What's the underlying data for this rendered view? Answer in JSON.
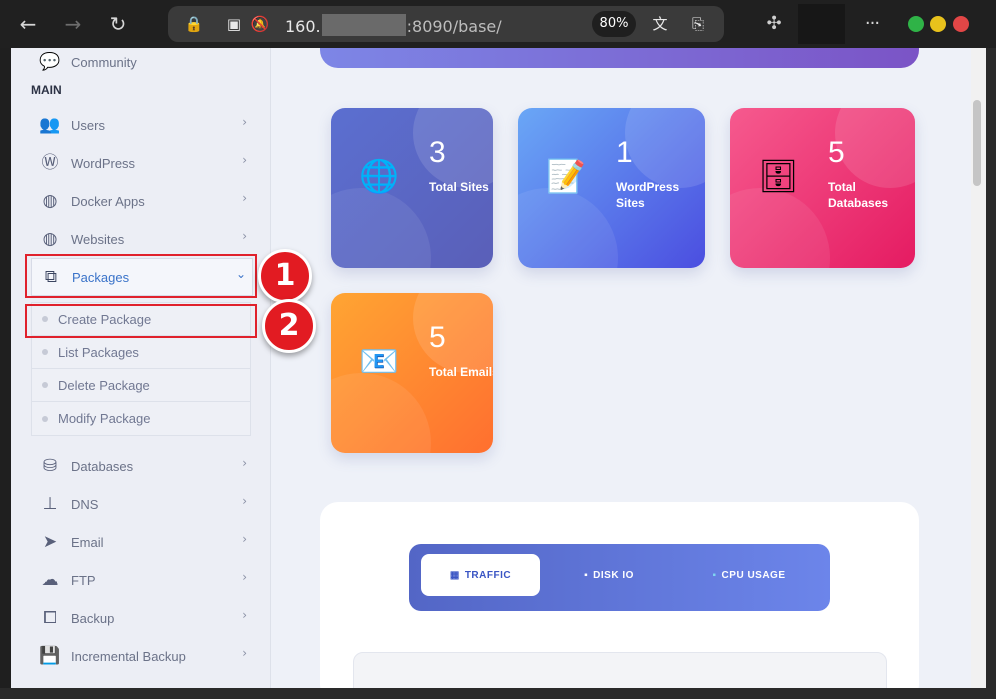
{
  "browser": {
    "back_icon": "arrow-left-icon",
    "forward_icon": "arrow-right-icon",
    "reload_icon": "reload-icon",
    "url_host": "160.",
    "url_rest": ":8090/base/",
    "zoom": "80%",
    "menu_glyph": "···"
  },
  "sidebar": {
    "community": "Community",
    "main_label": "MAIN",
    "items": [
      {
        "label": "Users",
        "icon": "users-icon"
      },
      {
        "label": "WordPress",
        "icon": "wordpress-icon"
      },
      {
        "label": "Docker Apps",
        "icon": "globe-icon"
      },
      {
        "label": "Websites",
        "icon": "globe-icon"
      },
      {
        "label": "Packages",
        "icon": "cubes-icon"
      },
      {
        "label": "Databases",
        "icon": "database-icon"
      },
      {
        "label": "DNS",
        "icon": "sitemap-icon"
      },
      {
        "label": "Email",
        "icon": "paper-plane-icon"
      },
      {
        "label": "FTP",
        "icon": "cloud-upload-icon"
      },
      {
        "label": "Backup",
        "icon": "copy-icon"
      },
      {
        "label": "Incremental Backup",
        "icon": "save-icon"
      }
    ],
    "packages_submenu": [
      "Create Package",
      "List Packages",
      "Delete Package",
      "Modify Package"
    ]
  },
  "annotations": {
    "badge_1": "1",
    "badge_2": "2",
    "color": "#e21b22"
  },
  "stats": [
    {
      "value": "3",
      "label": "Total Sites",
      "icon": "globe-icon"
    },
    {
      "value": "1",
      "label": "WordPress Sites",
      "icon": "document-pen-icon"
    },
    {
      "value": "5",
      "label": "Total Databases",
      "icon": "file-cabinet-icon"
    },
    {
      "value": "5",
      "label": "Total Emails",
      "icon": "email-icon"
    }
  ],
  "tabs": [
    {
      "label": "TRAFFIC",
      "active": true
    },
    {
      "label": "DISK IO",
      "active": false
    },
    {
      "label": "CPU USAGE",
      "active": false
    }
  ],
  "colors": {
    "accent": "#3a73c9",
    "card_sites": "#5b6fd0",
    "card_wordpress": "#4b4ee0",
    "card_databases": "#e51b62",
    "card_emails": "#ff6f2f"
  }
}
